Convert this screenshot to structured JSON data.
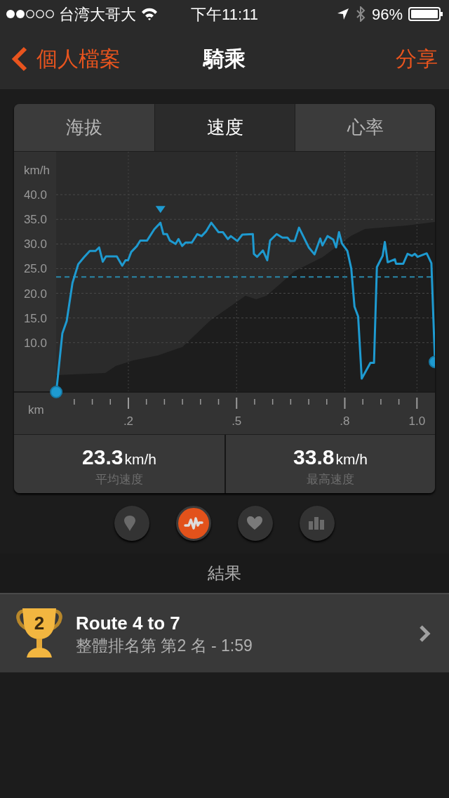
{
  "status_bar": {
    "carrier": "台湾大哥大",
    "time": "下午11:11",
    "battery": "96%"
  },
  "nav": {
    "back": "個人檔案",
    "title": "騎乘",
    "action": "分享"
  },
  "tabs": [
    {
      "label": "海拔",
      "selected": false
    },
    {
      "label": "速度",
      "selected": true
    },
    {
      "label": "心率",
      "selected": false
    }
  ],
  "chart_data": {
    "type": "line",
    "xlabel": "km",
    "ylabel": "km/h",
    "xlim": [
      -0.117,
      1.05
    ],
    "ylim": [
      0,
      48.7
    ],
    "grid": true,
    "xticks": [
      {
        "value": 0.2,
        "label": ".2"
      },
      {
        "value": 0.5,
        "label": ".5"
      },
      {
        "value": 0.8,
        "label": ".8"
      },
      {
        "value": 1.0,
        "label": "1.0"
      }
    ],
    "yticks": [
      {
        "value": 10,
        "label": "10.0"
      },
      {
        "value": 15,
        "label": "15.0"
      },
      {
        "value": 20,
        "label": "20.0"
      },
      {
        "value": 25,
        "label": "25.0"
      },
      {
        "value": 30,
        "label": "30.0"
      },
      {
        "value": 35,
        "label": "35.0"
      },
      {
        "value": 40,
        "label": "40.0"
      }
    ],
    "x": [
      0,
      0.017,
      0.029,
      0.045,
      0.061,
      0.077,
      0.093,
      0.109,
      0.119,
      0.129,
      0.138,
      0.168,
      0.183,
      0.192,
      0.199,
      0.208,
      0.224,
      0.233,
      0.252,
      0.272,
      0.289,
      0.297,
      0.307,
      0.315,
      0.331,
      0.339,
      0.349,
      0.359,
      0.376,
      0.391,
      0.403,
      0.416,
      0.43,
      0.45,
      0.462,
      0.476,
      0.484,
      0.502,
      0.516,
      0.545,
      0.548,
      0.557,
      0.573,
      0.585,
      0.593,
      0.611,
      0.627,
      0.641,
      0.649,
      0.661,
      0.673,
      0.7,
      0.716,
      0.732,
      0.738,
      0.752,
      0.768,
      0.776,
      0.784,
      0.792,
      0.807,
      0.818,
      0.827,
      0.837,
      0.847,
      0.871,
      0.881,
      0.889,
      0.905,
      0.911,
      0.919,
      0.939,
      0.942,
      0.962,
      0.974,
      0.986,
      0.994,
      1.002,
      1.027,
      1.04,
      1.05
    ],
    "series": [
      {
        "color": "#1e9ad0",
        "values": [
          0,
          11.9,
          14.4,
          22.1,
          25.9,
          27.3,
          28.6,
          28.6,
          29.3,
          26.4,
          27.5,
          27.5,
          25.6,
          26.7,
          26.7,
          28.4,
          29.6,
          30.7,
          30.7,
          33.0,
          34.3,
          32.0,
          32.0,
          30.7,
          30.0,
          31.0,
          29.6,
          30.3,
          30.3,
          32.0,
          31.6,
          32.6,
          34.3,
          32.4,
          32.4,
          31.0,
          31.6,
          30.6,
          31.9,
          32.0,
          28.0,
          27.4,
          28.7,
          26.7,
          30.7,
          32.0,
          31.3,
          31.3,
          30.6,
          30.6,
          33.3,
          29.3,
          27.9,
          31.1,
          29.7,
          31.6,
          30.9,
          29.3,
          32.4,
          30.1,
          28.6,
          25.0,
          17.3,
          15.3,
          2.7,
          5.9,
          5.9,
          25.3,
          27.6,
          30.4,
          26.3,
          26.9,
          26.0,
          26.0,
          28.0,
          27.6,
          28.0,
          27.4,
          28.1,
          26.1,
          6.1
        ]
      }
    ],
    "ref_lines": [
      {
        "axis": "y",
        "value": 23.3
      }
    ]
  },
  "stats": [
    {
      "value": "23.3",
      "unit": "km/h",
      "label": "平均速度"
    },
    {
      "value": "33.8",
      "unit": "km/h",
      "label": "最高速度"
    }
  ],
  "view_buttons": [
    {
      "kind": "pin",
      "selected": false
    },
    {
      "kind": "wave",
      "selected": true
    },
    {
      "kind": "heart",
      "selected": false
    },
    {
      "kind": "bars",
      "selected": false
    }
  ],
  "results": {
    "header": "結果",
    "items": [
      {
        "rank": "2",
        "title": "Route 4 to 7",
        "subtitle": "整體排名第 第2 名 - 1:59"
      }
    ]
  }
}
